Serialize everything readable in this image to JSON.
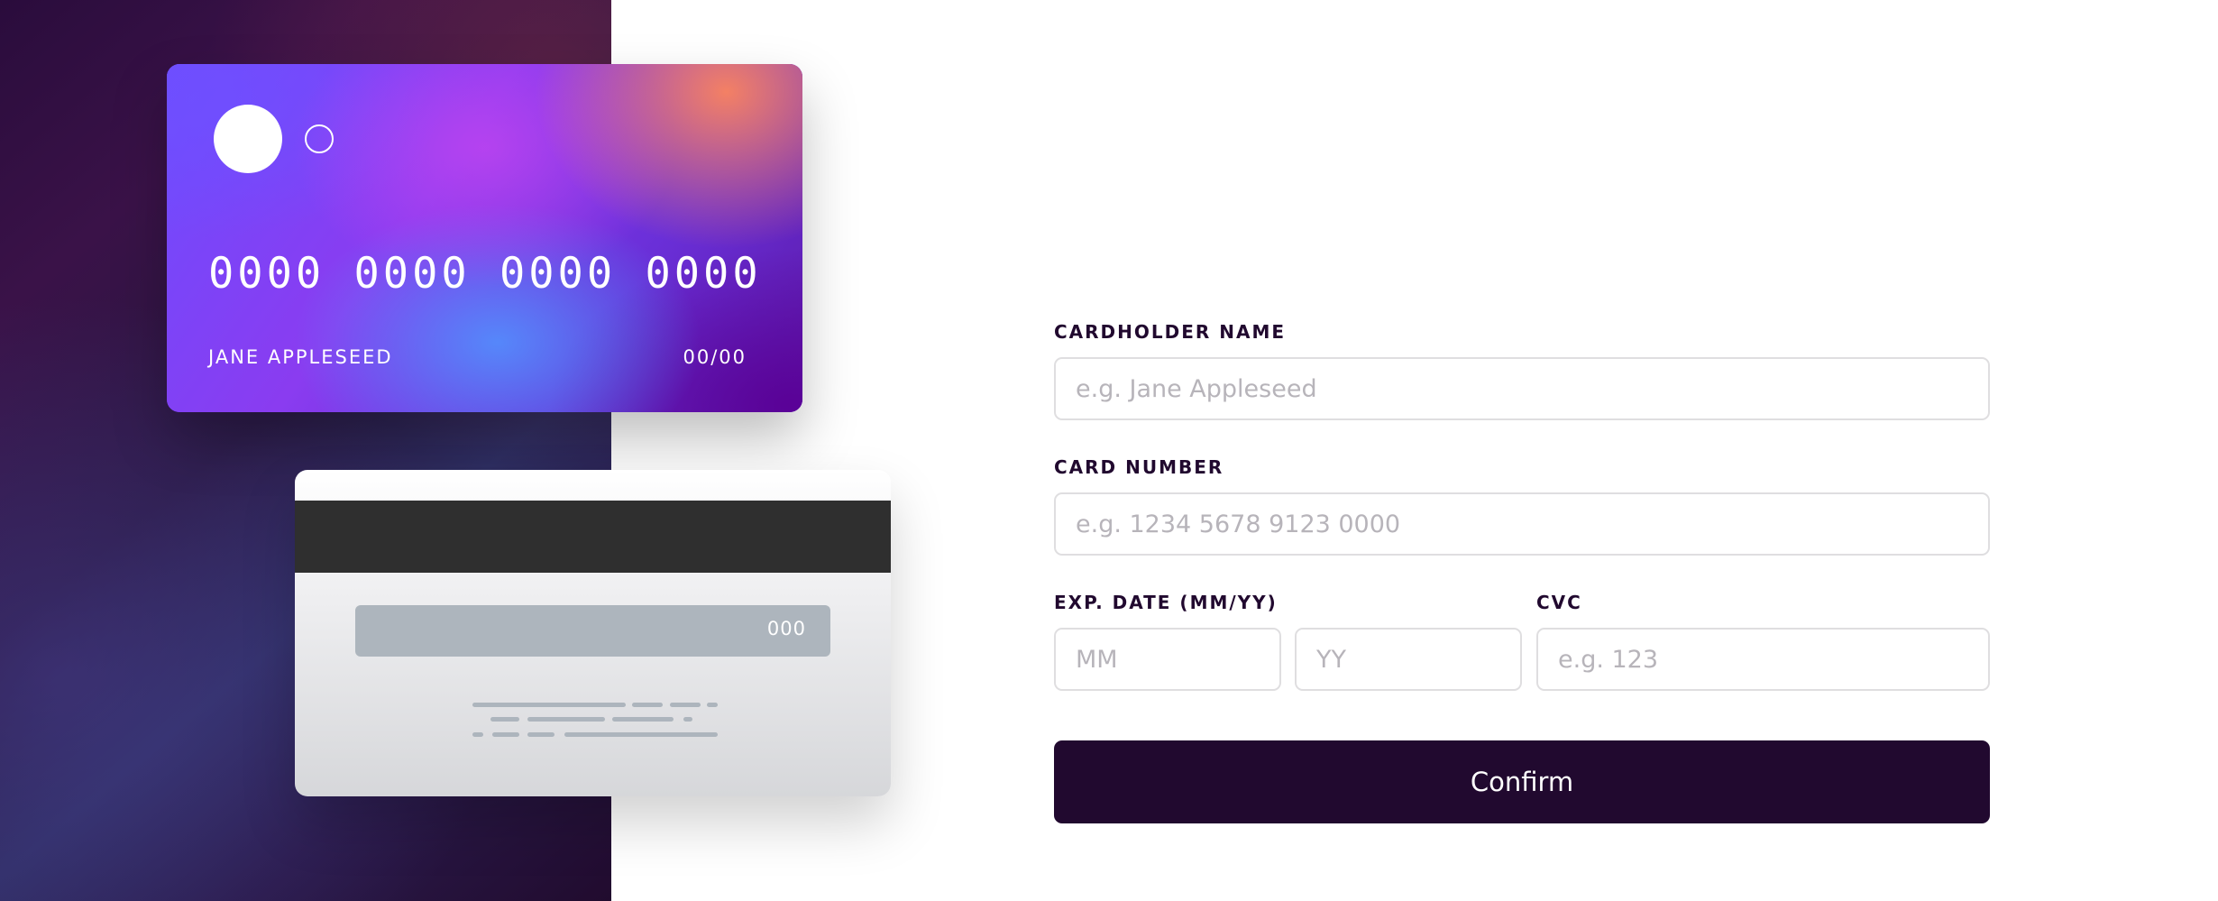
{
  "card_front": {
    "number": "0000 0000 0000 0000",
    "name": "JANE APPLESEED",
    "expiry": "00/00"
  },
  "card_back": {
    "cvc": "000"
  },
  "form": {
    "cardholder": {
      "label": "CARDHOLDER NAME",
      "placeholder": "e.g. Jane Appleseed"
    },
    "card_number": {
      "label": "CARD NUMBER",
      "placeholder": "e.g. 1234 5678 9123 0000"
    },
    "expiry": {
      "label": "EXP. DATE (MM/YY)",
      "month_placeholder": "MM",
      "year_placeholder": "YY"
    },
    "cvc": {
      "label": "CVC",
      "placeholder": "e.g. 123"
    },
    "confirm_label": "Confirm"
  },
  "colors": {
    "dark_violet": "#21092f",
    "border_gray": "#dfdee0",
    "placeholder_gray": "#b7b4ba"
  }
}
